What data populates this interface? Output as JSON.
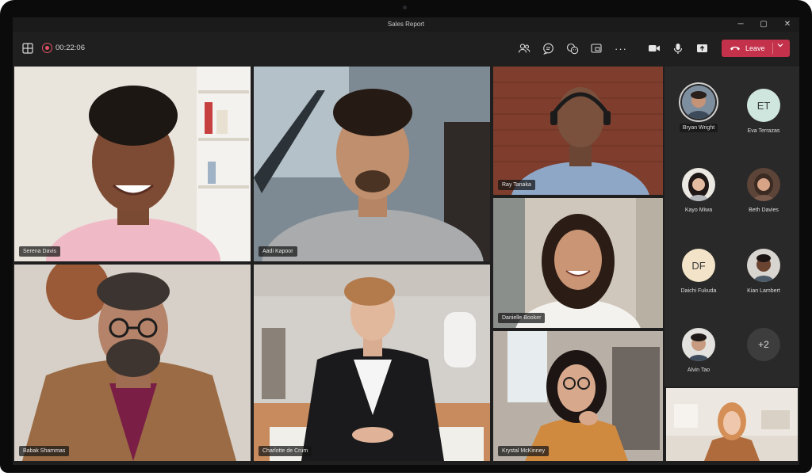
{
  "window": {
    "title": "Sales Report",
    "minimize": "─",
    "maximize": "▢",
    "close": "✕"
  },
  "toolbar": {
    "timer": "00:22:06",
    "leave_label": "Leave",
    "icons": [
      "grid-view-icon",
      "recording-icon",
      "people-icon",
      "chat-icon",
      "reactions-icon",
      "rooms-icon",
      "more-icon",
      "camera-icon",
      "mic-icon",
      "share-icon",
      "phone-hangup-icon",
      "chevron-down-icon"
    ]
  },
  "tiles": [
    {
      "name": "Serena Davis"
    },
    {
      "name": "Aadi Kapoor"
    },
    {
      "name": "Ray Tanaka"
    },
    {
      "name": "Danielle Booker"
    },
    {
      "name": "Babak Shammas"
    },
    {
      "name": "Charlotte de Crum"
    },
    {
      "name": "Krystal McKinney"
    }
  ],
  "roster": [
    {
      "name": "Bryan Wright",
      "initials": "",
      "active": true
    },
    {
      "name": "Eva Terrazas",
      "initials": "ET",
      "color": "#cfe6de"
    },
    {
      "name": "Kayo Miwa",
      "initials": ""
    },
    {
      "name": "Beth Davies",
      "initials": ""
    },
    {
      "name": "Daichi Fukuda",
      "initials": "DF",
      "color": "#f3e3c8"
    },
    {
      "name": "Kian Lambert",
      "initials": ""
    },
    {
      "name": "Alvin Tao",
      "initials": ""
    },
    {
      "name": "",
      "initials": "+2"
    }
  ],
  "colors": {
    "leave": "#c4314b",
    "recording": "#e05363",
    "panel": "#292929"
  }
}
